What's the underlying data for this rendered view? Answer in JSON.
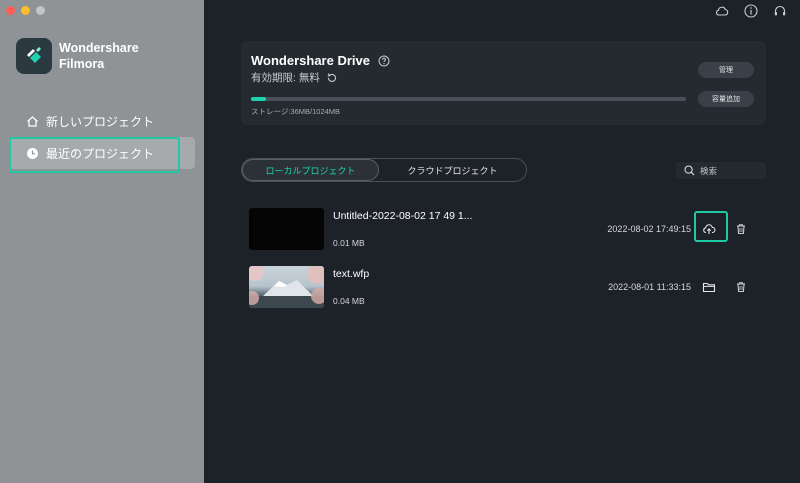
{
  "app": {
    "name_line1": "Wondershare",
    "name_line2": "Filmora"
  },
  "sidebar": {
    "items": [
      {
        "label": "新しいプロジェクト",
        "icon": "home-icon"
      },
      {
        "label": "最近のプロジェクト",
        "icon": "clock-icon",
        "selected": true
      }
    ]
  },
  "top_icons": [
    "cloud-icon",
    "info-icon",
    "headset-icon"
  ],
  "drive": {
    "title": "Wondershare Drive",
    "subtitle": "有効期限: 無料",
    "storage_text": "ストレージ:36MB/1024MB",
    "storage_used_fraction": 0.035,
    "manage_label": "管理",
    "add_capacity_label": "容量追加"
  },
  "tabs": {
    "local": "ローカルプロジェクト",
    "cloud": "クラウドプロジェクト",
    "active": "local"
  },
  "search": {
    "placeholder": "検索"
  },
  "projects": [
    {
      "name": "Untitled-2022-08-02 17 49 1...",
      "size": "0.01 MB",
      "date": "2022-08-02 17:49:15",
      "action_icon": "cloud-upload-icon"
    },
    {
      "name": "text.wfp",
      "size": "0.04 MB",
      "date": "2022-08-01 11:33:15",
      "action_icon": "folder-icon"
    }
  ],
  "colors": {
    "accent": "#1fd2ae",
    "highlight_outline": "#20c9a5",
    "sidebar_bg": "#8f9396",
    "main_bg": "#1d2128"
  }
}
